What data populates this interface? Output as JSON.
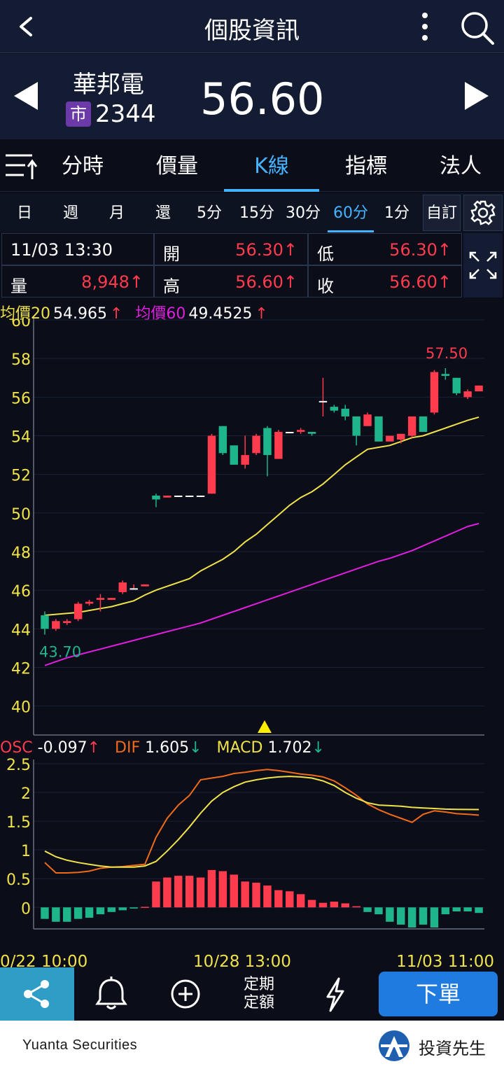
{
  "header": {
    "title": "個股資訊",
    "back_icon": "chevron-left-icon",
    "more_icon": "more-vertical-icon",
    "search_icon": "search-icon"
  },
  "stock": {
    "name": "華邦電",
    "market_badge": "市",
    "code": "2344",
    "price": "56.60"
  },
  "tabs": [
    {
      "label": "分時",
      "active": false
    },
    {
      "label": "價量",
      "active": false
    },
    {
      "label": "K線",
      "active": true
    },
    {
      "label": "指標",
      "active": false
    },
    {
      "label": "法人",
      "active": false
    }
  ],
  "periods": [
    {
      "label": "日",
      "active": false
    },
    {
      "label": "週",
      "active": false
    },
    {
      "label": "月",
      "active": false
    },
    {
      "label": "還",
      "active": false
    },
    {
      "label": "5分",
      "active": false
    },
    {
      "label": "15分",
      "active": false
    },
    {
      "label": "30分",
      "active": false
    },
    {
      "label": "60分",
      "active": true
    },
    {
      "label": "1分",
      "active": false
    }
  ],
  "customize_label": "自訂",
  "quote": {
    "datetime": "11/03 13:30",
    "open_label": "開",
    "open": "56.30↑",
    "low_label": "低",
    "low": "56.30↑",
    "volume_label": "量",
    "volume": "8,948↑",
    "high_label": "高",
    "high": "56.60↑",
    "close_label": "收",
    "close": "56.60↑"
  },
  "ma_legend": {
    "ma20_label": "均價20",
    "ma20": "54.965",
    "ma20_arrow": "↑",
    "ma60_label": "均價60",
    "ma60": "49.4525",
    "ma60_arrow": "↑"
  },
  "macd_legend": {
    "osc_label": "OSC",
    "osc": "-0.097",
    "osc_arrow": "↑",
    "dif_label": "DIF",
    "dif": "1.605",
    "dif_arrow": "↓",
    "macd_label": "MACD",
    "macd": "1.702",
    "macd_arrow": "↓"
  },
  "colors": {
    "up": "#ff3b4e",
    "down": "#1fb58a",
    "ma20": "#f0e24a",
    "ma60": "#e01ee0",
    "dif": "#f06a1a",
    "macd": "#f0e24a",
    "accent": "#45b3ff"
  },
  "chart_data": [
    {
      "type": "candlestick",
      "title": "",
      "ylim": [
        38.5,
        60
      ],
      "yticks": [
        "40",
        "42",
        "44",
        "46",
        "48",
        "50",
        "52",
        "54",
        "56",
        "58",
        "60"
      ],
      "annotations": {
        "high_label": "57.50",
        "low_label": "43.70"
      },
      "candles": [
        [
          44.7,
          44.0,
          44.9,
          43.7
        ],
        [
          44.0,
          44.4,
          44.5,
          43.9
        ],
        [
          44.3,
          44.4,
          44.5,
          44.2
        ],
        [
          44.5,
          45.3,
          45.4,
          44.4
        ],
        [
          45.3,
          45.4,
          45.5,
          45.2
        ],
        [
          45.5,
          45.6,
          45.8,
          44.9
        ],
        [
          45.5,
          45.6,
          45.6,
          45.5
        ],
        [
          45.9,
          46.4,
          46.5,
          45.8
        ],
        [
          46.1,
          46.1,
          46.3,
          46.1
        ],
        [
          46.2,
          46.3,
          46.3,
          46.2
        ],
        [
          50.9,
          50.7,
          51.0,
          50.3
        ],
        [
          50.8,
          50.9,
          50.9,
          50.8
        ],
        [
          50.9,
          50.9,
          50.9,
          50.9
        ],
        [
          50.9,
          50.9,
          50.9,
          50.9
        ],
        [
          50.9,
          50.9,
          50.9,
          50.9
        ],
        [
          51.0,
          54.0,
          54.1,
          51.0
        ],
        [
          54.5,
          53.1,
          54.5,
          53.0
        ],
        [
          53.5,
          52.5,
          53.5,
          52.5
        ],
        [
          52.5,
          53.0,
          54.0,
          52.3
        ],
        [
          53.1,
          54.0,
          54.1,
          53.0
        ],
        [
          54.4,
          53.0,
          54.5,
          51.9
        ],
        [
          52.8,
          54.2,
          54.3,
          52.8
        ],
        [
          54.2,
          54.2,
          54.2,
          54.2
        ],
        [
          54.2,
          54.3,
          54.4,
          54.1
        ],
        [
          54.2,
          54.1,
          54.2,
          54.0
        ],
        [
          55.8,
          55.8,
          57.0,
          55.0
        ],
        [
          55.5,
          55.3,
          55.6,
          55.2
        ],
        [
          55.4,
          55.0,
          55.6,
          54.8
        ],
        [
          55.0,
          54.0,
          55.0,
          53.5
        ],
        [
          54.5,
          55.1,
          55.2,
          54.5
        ],
        [
          55.0,
          53.7,
          55.0,
          53.7
        ],
        [
          53.7,
          54.0,
          54.0,
          53.7
        ],
        [
          53.8,
          54.1,
          54.1,
          53.6
        ],
        [
          54.0,
          55.0,
          55.0,
          53.9
        ],
        [
          55.0,
          54.2,
          55.0,
          54.2
        ],
        [
          55.2,
          57.3,
          57.4,
          55.1
        ],
        [
          57.2,
          57.1,
          57.5,
          56.9
        ],
        [
          57.0,
          56.2,
          57.0,
          56.1
        ],
        [
          56.0,
          56.3,
          56.4,
          55.9
        ],
        [
          56.3,
          56.6,
          56.6,
          56.3
        ]
      ],
      "series": [
        {
          "name": "均價20",
          "values": [
            44.7,
            44.75,
            44.8,
            44.85,
            44.95,
            45.05,
            45.15,
            45.3,
            45.45,
            45.75,
            46.0,
            46.2,
            46.4,
            46.6,
            47.0,
            47.3,
            47.6,
            48.0,
            48.5,
            48.9,
            49.4,
            49.9,
            50.4,
            50.8,
            51.1,
            51.5,
            52.0,
            52.5,
            52.9,
            53.3,
            53.4,
            53.5,
            53.7,
            53.9,
            54.0,
            54.2,
            54.4,
            54.6,
            54.8,
            54.965
          ]
        },
        {
          "name": "均價60",
          "values": [
            42.1,
            42.3,
            42.5,
            42.65,
            42.8,
            42.95,
            43.1,
            43.25,
            43.4,
            43.55,
            43.7,
            43.85,
            44.0,
            44.15,
            44.3,
            44.5,
            44.7,
            44.9,
            45.1,
            45.3,
            45.5,
            45.7,
            45.9,
            46.1,
            46.3,
            46.5,
            46.7,
            46.9,
            47.1,
            47.3,
            47.5,
            47.65,
            47.85,
            48.05,
            48.3,
            48.55,
            48.8,
            49.05,
            49.3,
            49.4525
          ]
        }
      ]
    },
    {
      "type": "bar",
      "title": "",
      "ylim": [
        -0.35,
        2.5
      ],
      "yticks": [
        "0",
        "0.5",
        "1",
        "1.5",
        "2",
        "2.5"
      ],
      "osc": [
        -0.2,
        -0.25,
        -0.25,
        -0.2,
        -0.18,
        -0.12,
        -0.08,
        -0.05,
        -0.02,
        0.01,
        0.45,
        0.52,
        0.55,
        0.55,
        0.52,
        0.65,
        0.63,
        0.57,
        0.45,
        0.43,
        0.38,
        0.3,
        0.28,
        0.23,
        0.13,
        0.08,
        0.1,
        0.07,
        0.02,
        -0.08,
        -0.12,
        -0.25,
        -0.3,
        -0.35,
        -0.3,
        -0.35,
        -0.12,
        -0.07,
        -0.07,
        -0.097
      ],
      "series": [
        {
          "name": "DIF",
          "values": [
            0.78,
            0.6,
            0.6,
            0.61,
            0.63,
            0.68,
            0.7,
            0.71,
            0.73,
            0.75,
            1.22,
            1.55,
            1.78,
            1.95,
            2.22,
            2.25,
            2.28,
            2.33,
            2.35,
            2.38,
            2.4,
            2.38,
            2.35,
            2.32,
            2.3,
            2.27,
            2.2,
            2.08,
            1.95,
            1.8,
            1.7,
            1.62,
            1.55,
            1.48,
            1.62,
            1.68,
            1.66,
            1.63,
            1.62,
            1.605
          ]
        },
        {
          "name": "MACD",
          "values": [
            0.98,
            0.88,
            0.82,
            0.78,
            0.75,
            0.72,
            0.7,
            0.7,
            0.7,
            0.72,
            0.8,
            0.98,
            1.18,
            1.4,
            1.64,
            1.85,
            2.0,
            2.1,
            2.18,
            2.22,
            2.25,
            2.27,
            2.28,
            2.27,
            2.25,
            2.2,
            2.12,
            2.0,
            1.9,
            1.82,
            1.78,
            1.77,
            1.76,
            1.74,
            1.73,
            1.72,
            1.71,
            1.705,
            1.703,
            1.702
          ]
        }
      ]
    }
  ],
  "x_labels": [
    "0/22 10:00",
    "10/28 13:00",
    "11/03 11:00"
  ],
  "toolbar": {
    "dq_line1": "定期",
    "dq_line2": "定額",
    "order_label": "下單"
  },
  "footer": {
    "brand": "Yuanta Securities",
    "mascot": "投資先生"
  }
}
